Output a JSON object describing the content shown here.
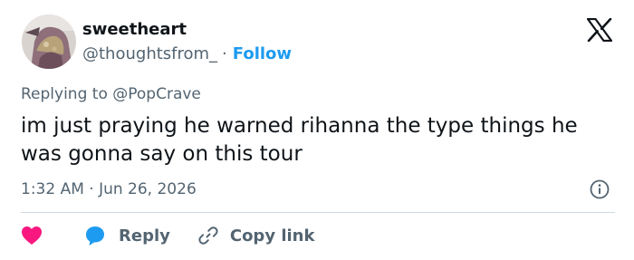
{
  "author": {
    "name": "sweetheart",
    "handle": "@thoughtsfrom_",
    "separator": "·",
    "follow_label": "Follow"
  },
  "tweet": {
    "replying_to_prefix": "Replying to ",
    "replying_to_handle": "@PopCrave",
    "text": "im just praying he warned rihanna the type things he was gonna say on this tour",
    "timestamp": "1:32 AM · Jun 26, 2026"
  },
  "actions": {
    "like_icon": "heart-icon",
    "reply_icon": "speech-bubble-icon",
    "reply_label": "Reply",
    "copy_icon": "link-icon",
    "copy_label": "Copy link"
  },
  "colors": {
    "accent": "#1d9bf0",
    "like": "#f91880",
    "secondary_text": "#536471",
    "primary_text": "#0f1419",
    "divider": "#cfd9de"
  }
}
